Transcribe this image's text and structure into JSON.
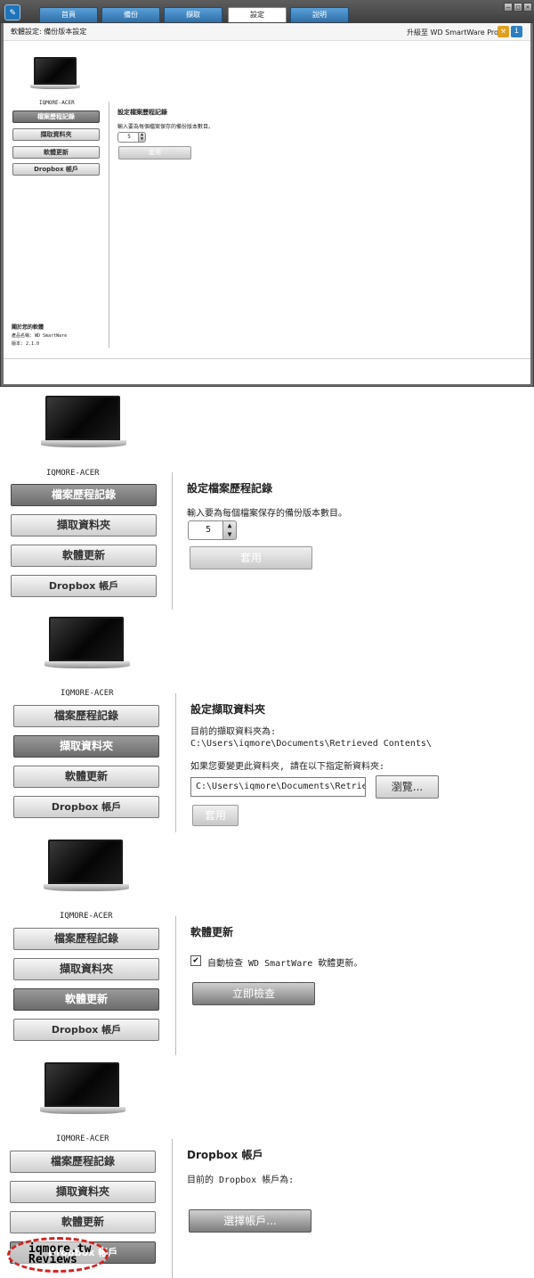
{
  "app": {
    "logo_glyph": "✎",
    "accent": "#1e74b8"
  },
  "tabs": [
    {
      "label": "首頁"
    },
    {
      "label": "備份"
    },
    {
      "label": "擷取"
    },
    {
      "label": "設定",
      "active": true
    },
    {
      "label": "說明"
    }
  ],
  "window_buttons": {
    "minimize": "–",
    "maximize": "□",
    "close": "×"
  },
  "header": {
    "breadcrumb": "軟體設定: 備份版本設定",
    "upgrade": "升級至 WD SmartWare Pro"
  },
  "small": {
    "device_name": "IQMORE-ACER",
    "nav": [
      "檔案歷程記錄",
      "擷取資料夾",
      "軟體更新",
      "Dropbox 帳戶"
    ],
    "content_title": "設定檔案歷程記錄",
    "content_desc": "輸入要為每個檔案保存的備份版本數目。",
    "version_count": "5",
    "apply": "套用",
    "about_title": "關於您的軟體",
    "about_product": "產品名稱: WD SmartWare",
    "about_version": "版本: 2.1.0"
  },
  "panels": [
    {
      "device_name": "IQMORE-ACER",
      "nav": [
        "檔案歷程記錄",
        "擷取資料夾",
        "軟體更新",
        "Dropbox 帳戶"
      ],
      "selected": 0,
      "title": "設定檔案歷程記錄",
      "desc": "輸入要為每個檔案保存的備份版本數目。",
      "version_count": "5",
      "apply": "套用"
    },
    {
      "device_name": "IQMORE-ACER",
      "nav": [
        "檔案歷程記錄",
        "擷取資料夾",
        "軟體更新",
        "Dropbox 帳戶"
      ],
      "selected": 1,
      "title": "設定擷取資料夾",
      "current_label": "目前的擷取資料夾為:",
      "current_path": "C:\\Users\\iqmore\\Documents\\Retrieved Contents\\",
      "change_label": "如果您要變更此資料夾, 請在以下指定新資料夾:",
      "path_field": "C:\\Users\\iqmore\\Documents\\Retrieve",
      "browse": "瀏覽...",
      "apply": "套用"
    },
    {
      "device_name": "IQMORE-ACER",
      "nav": [
        "檔案歷程記錄",
        "擷取資料夾",
        "軟體更新",
        "Dropbox 帳戶"
      ],
      "selected": 2,
      "title": "軟體更新",
      "auto_check": "自動檢查 WD SmartWare 軟體更新。",
      "auto_checked": true,
      "check_now": "立即檢查"
    },
    {
      "device_name": "IQMORE-ACER",
      "nav": [
        "檔案歷程記錄",
        "擷取資料夾",
        "軟體更新",
        "Dropbox 帳戶"
      ],
      "selected": 3,
      "title": "Dropbox 帳戶",
      "current_account": "目前的 Dropbox 帳戶為:",
      "choose_account": "選擇帳戶..."
    }
  ],
  "watermark": {
    "line1": "iqmore.tw",
    "line2": "Reviews",
    "color": "#d22222"
  }
}
